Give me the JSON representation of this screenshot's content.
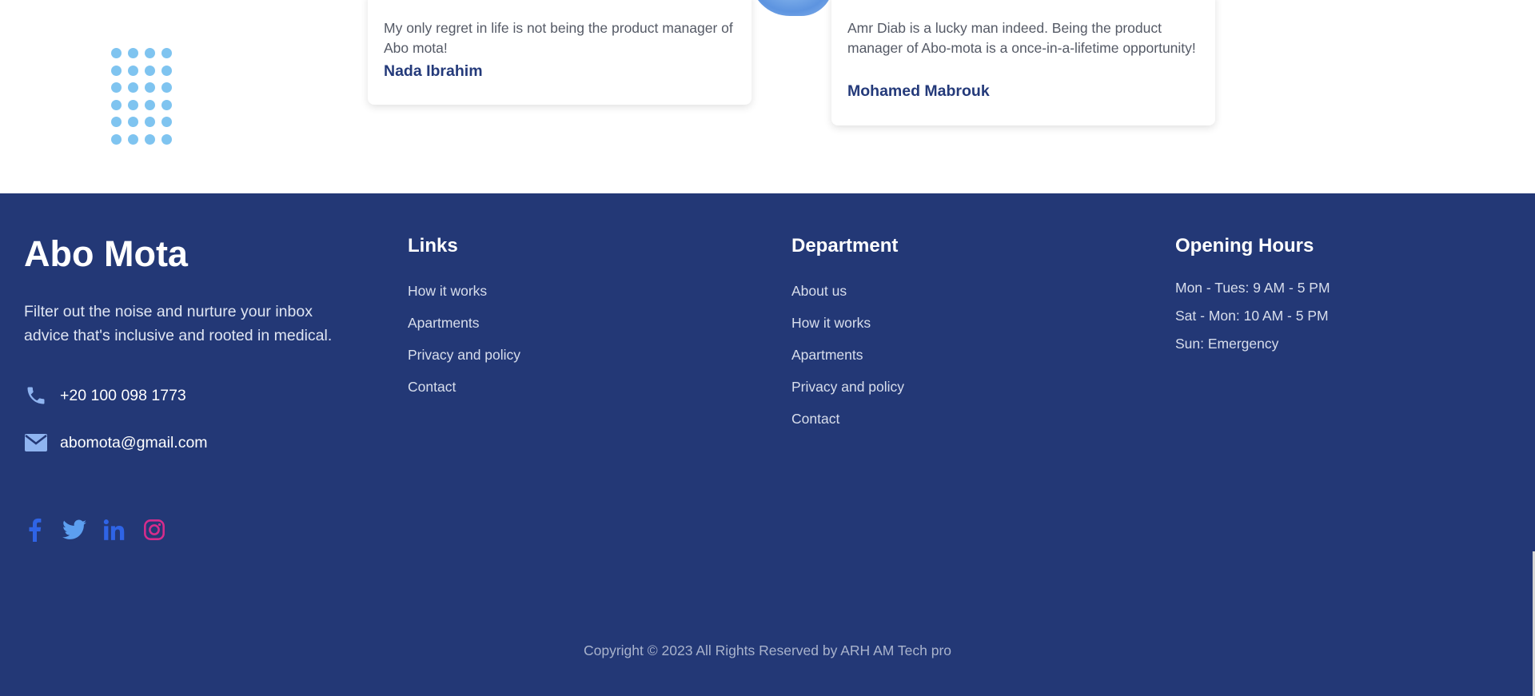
{
  "testimonials": [
    {
      "quote": "My only regret in life is not being the product manager of Abo mota!",
      "author": "Nada Ibrahim"
    },
    {
      "quote": "Amr Diab is a lucky man indeed. Being the product manager of Abo-mota is a once-in-a-lifetime opportunity!",
      "author": "Mohamed Mabrouk"
    }
  ],
  "footer": {
    "brand": "Abo Mota",
    "tagline": "Filter out the noise and nurture your inbox advice that's inclusive and rooted in medical.",
    "phone": "+20 100 098 1773",
    "email": "abomota@gmail.com",
    "phone_icon": "phone-icon",
    "email_icon": "envelope-icon",
    "links": {
      "title": "Links",
      "items": [
        "How it works",
        "Apartments",
        "Privacy and policy",
        "Contact"
      ]
    },
    "department": {
      "title": "Department",
      "items": [
        "About us",
        "How it works",
        "Apartments",
        "Privacy and policy",
        "Contact"
      ]
    },
    "hours": {
      "title": "Opening Hours",
      "items": [
        "Mon - Tues: 9 AM - 5 PM",
        "Sat - Mon: 10 AM - 5 PM",
        "Sun: Emergency"
      ]
    },
    "social": [
      "facebook-icon",
      "twitter-icon",
      "linkedin-icon",
      "instagram-icon"
    ],
    "copyright": "Copyright © 2023 All Rights Reserved by ARH AM Tech pro"
  },
  "colors": {
    "footer_bg": "#233876",
    "author": "#243a7a",
    "dots": "#7fc4f0",
    "facebook": "#2f64e6",
    "twitter": "#5c9ff0",
    "linkedin": "#2f64e6",
    "instagram": "#d62c8c"
  }
}
